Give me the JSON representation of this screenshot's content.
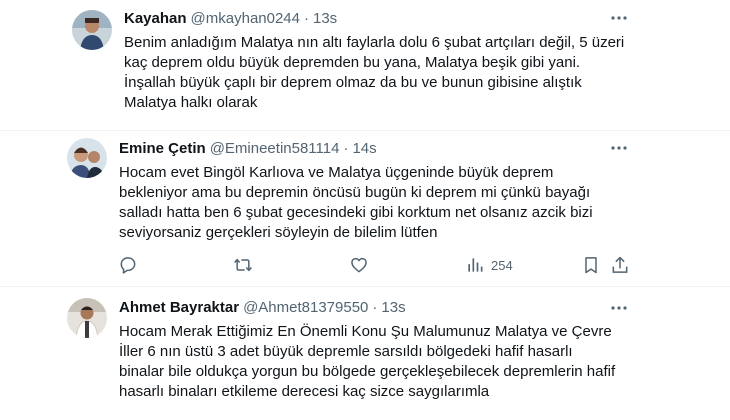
{
  "tweets": [
    {
      "name": "Kayahan",
      "handle": "@mkayhan0244",
      "separator": "·",
      "time": "13s",
      "lines": [
        "Benim anladığım Malatya nın altı faylarla dolu 6 şubat artçıları değil, 5 üzeri",
        "kaç deprem oldu büyük depremden bu yana, Malatya beşik gibi yani.",
        "İnşallah büyük çaplı bir deprem olmaz da bu ve bunun gibisine alıştık",
        "Malatya halkı olarak"
      ]
    },
    {
      "name": "Emine Çetin",
      "handle": "@Emineetin581114",
      "separator": "·",
      "time": "14s",
      "lines": [
        "Hocam evet Bingöl Karlıova ve Malatya üçgeninde büyük deprem",
        "bekleniyor ama bu depremin öncüsü bugün ki deprem mi çünkü bayağı",
        "salladı hatta ben 6 şubat gecesindeki gibi korktum net olsanız azcik bizi",
        "seviyorsaniz gerçekleri söyleyin de bilelim lütfen"
      ],
      "views": "254"
    },
    {
      "name": "Ahmet Bayraktar",
      "handle": "@Ahmet81379550",
      "separator": "·",
      "time": "13s",
      "lines": [
        "Hocam Merak Ettiğimiz En Önemli Konu Şu Malumunuz Malatya ve Çevre",
        "İller 6 nın üstü 3 adet büyük depremle sarsıldı bölgedeki hafif hasarlı",
        "binalar bile oldukça yorgun bu bölgede gerçekleşebilecek depremlerin hafif",
        "hasarlı binaları etkileme derecesi kaç sizce saygılarımla"
      ]
    }
  ],
  "icons": {
    "more": "more-horizontal-icon",
    "reply": "reply-icon",
    "retweet": "retweet-icon",
    "like": "like-icon",
    "views": "views-icon",
    "bookmark": "bookmark-icon",
    "share": "share-icon"
  },
  "colors": {
    "text": "#0f1419",
    "secondary": "#536471",
    "divider": "#eff3f4"
  }
}
